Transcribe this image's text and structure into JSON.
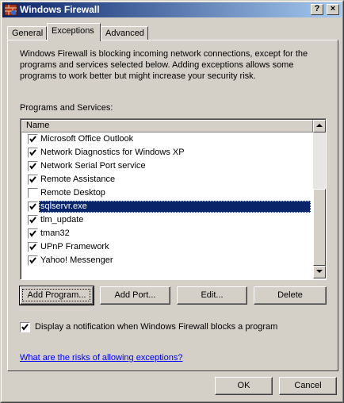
{
  "window": {
    "title": "Windows Firewall",
    "help_label": "?",
    "close_label": "×"
  },
  "tabs": [
    {
      "label": "General",
      "active": false
    },
    {
      "label": "Exceptions",
      "active": true
    },
    {
      "label": "Advanced",
      "active": false
    }
  ],
  "exceptions": {
    "description": "Windows Firewall is blocking incoming network connections, except for the programs and services selected below. Adding exceptions allows some programs to work better but might increase your security risk.",
    "programs_label": "Programs and Services:",
    "list_header": "Name",
    "items": [
      {
        "label": "Microsoft Office Outlook",
        "checked": true,
        "selected": false
      },
      {
        "label": "Network Diagnostics for Windows XP",
        "checked": true,
        "selected": false
      },
      {
        "label": "Network Serial Port service",
        "checked": true,
        "selected": false
      },
      {
        "label": "Remote Assistance",
        "checked": true,
        "selected": false
      },
      {
        "label": "Remote Desktop",
        "checked": false,
        "selected": false
      },
      {
        "label": "sqlservr.exe",
        "checked": true,
        "selected": true
      },
      {
        "label": "tlm_update",
        "checked": true,
        "selected": false
      },
      {
        "label": "tman32",
        "checked": true,
        "selected": false
      },
      {
        "label": "UPnP Framework",
        "checked": true,
        "selected": false
      },
      {
        "label": "Yahoo! Messenger",
        "checked": true,
        "selected": false
      }
    ],
    "buttons": {
      "add_program": "Add Program...",
      "add_port": "Add Port...",
      "edit": "Edit...",
      "delete": "Delete"
    },
    "notify_label": "Display a notification when Windows Firewall blocks a program",
    "notify_checked": true,
    "risk_link": "What are the risks of allowing exceptions?"
  },
  "dialog_buttons": {
    "ok": "OK",
    "cancel": "Cancel"
  },
  "colors": {
    "title_start": "#0a246a",
    "title_end": "#a6caf0",
    "face": "#d4d0c8",
    "selection": "#0a246a",
    "link": "#0000ff"
  },
  "icons": {
    "app": "firewall-brick-icon",
    "check": "check-mark-icon",
    "scroll_up": "arrow-up-icon",
    "scroll_down": "arrow-down-icon"
  }
}
